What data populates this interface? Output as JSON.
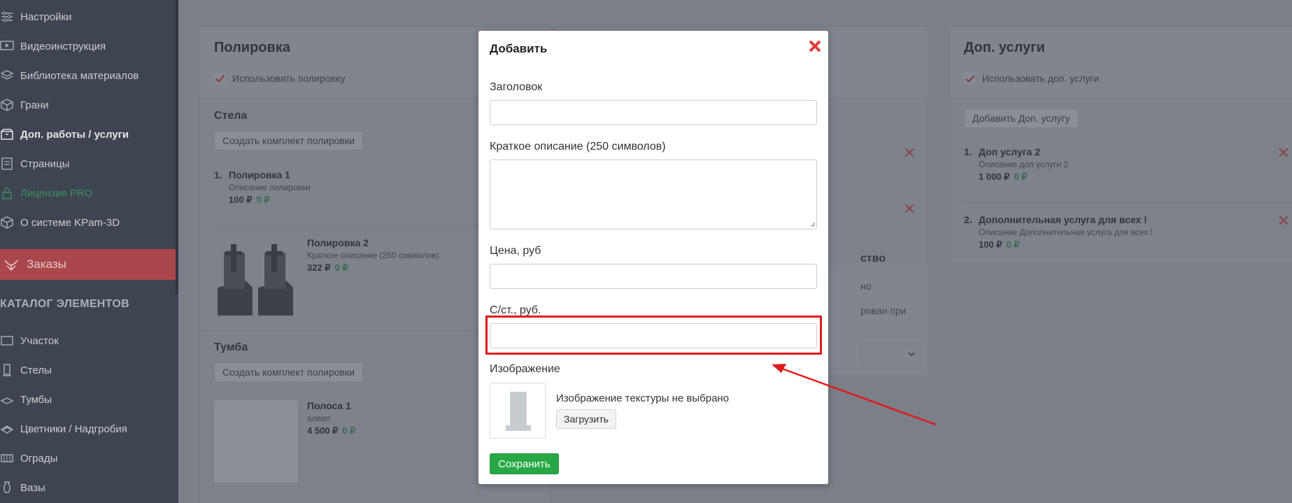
{
  "sidebar": {
    "items": [
      {
        "label": "Настройки",
        "icon": "sliders-icon"
      },
      {
        "label": "Видеоинструкция",
        "icon": "video-icon"
      },
      {
        "label": "Библиотека материалов",
        "icon": "layers-icon"
      },
      {
        "label": "Грани",
        "icon": "cube-icon"
      },
      {
        "label": "Доп. работы / услуги",
        "icon": "box-icon"
      },
      {
        "label": "Страницы",
        "icon": "pages-icon"
      },
      {
        "label": "Лицензия PRO",
        "icon": "lock-icon"
      },
      {
        "label": "О системе KPam-3D",
        "icon": "info-cube-icon"
      }
    ],
    "orders": {
      "label": "Заказы",
      "icon": "orders-icon"
    },
    "catalog_heading": "КАТАЛОГ ЭЛЕМЕНТОВ",
    "catalog_items": [
      {
        "label": "Участок",
        "icon": "plot-icon"
      },
      {
        "label": "Стелы",
        "icon": "stele-icon"
      },
      {
        "label": "Тумбы",
        "icon": "pedestal-icon"
      },
      {
        "label": "Цветники / Надгробия",
        "icon": "flowerbed-icon"
      },
      {
        "label": "Ограды",
        "icon": "fence-icon"
      },
      {
        "label": "Вазы",
        "icon": "vase-icon"
      }
    ]
  },
  "polishing": {
    "title": "Полировка",
    "use_checkbox": "Использовать полировку",
    "stele": {
      "title": "Стела",
      "create_button": "Создать комплект полировки",
      "items": [
        {
          "num": "1.",
          "title": "Полировка 1",
          "desc": "Описание полировки",
          "price": "100 ₽",
          "cost": "0 ₽"
        },
        {
          "num": "",
          "title": "Полировка 2",
          "desc": "Краткое описание (250 символов)",
          "price": "322 ₽",
          "cost": "0 ₽"
        }
      ]
    },
    "pedestal": {
      "title": "Тумба",
      "create_button": "Создать комплект полировки",
      "items": [
        {
          "title": "Полоса 1",
          "desc": "алвап",
          "price": "4 500 ₽",
          "cost": "0 ₽"
        }
      ]
    }
  },
  "middle": {
    "frag1": "ство",
    "frag2": "но",
    "frag3": "рован при"
  },
  "extra": {
    "title": "Доп. услуги",
    "use_checkbox": "Использовать доп. услуги",
    "add_button": "Добавить Доп. услугу",
    "items": [
      {
        "num": "1.",
        "title": "Доп услуга 2",
        "desc": "Описание доп услуги 2",
        "price": "1 000 ₽",
        "cost": "0 ₽"
      },
      {
        "num": "2.",
        "title": "Дополнительная услуга для всех !",
        "desc": "Описание Дополнительная услуга для всех !",
        "price": "100 ₽",
        "cost": "0 ₽"
      }
    ]
  },
  "modal": {
    "title": "Добавить",
    "fields": {
      "heading_label": "Заголовок",
      "desc_label": "Краткое описание (250 символов)",
      "price_label": "Цена, руб",
      "cost_label": "С/ст., руб.",
      "image_label": "Изображение"
    },
    "image_status": "Изображение текстуры не выбрано",
    "upload_button": "Загрузить",
    "save_button": "Сохранить"
  },
  "colors": {
    "accent_red": "#e01b1b",
    "save_green": "#28a745",
    "overlay": "#7a7f88"
  }
}
